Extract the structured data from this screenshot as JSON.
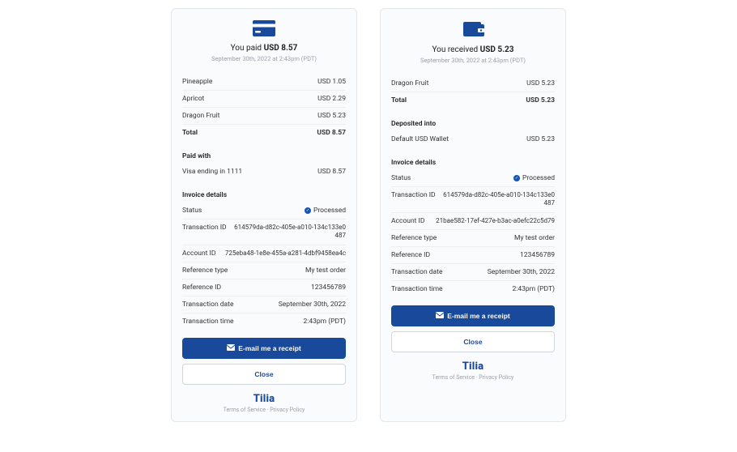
{
  "colors": {
    "primary": "#19499b",
    "muted": "#9aa1a9",
    "border": "#eceef0"
  },
  "left": {
    "title_prefix": "You paid ",
    "title_bold": "USD 8.57",
    "subtitle": "September 30th, 2022 at 2:43pm (PDT)",
    "items": [
      {
        "name": "Pineapple",
        "price": "USD 1.05"
      },
      {
        "name": "Apricot",
        "price": "USD 2.29"
      },
      {
        "name": "Dragon Fruit",
        "price": "USD 5.23"
      }
    ],
    "total": {
      "label": "Total",
      "amount": "USD 8.57"
    },
    "paid_with": {
      "label": "Paid with",
      "method": "Visa ending in 1111",
      "amount": "USD 8.57"
    },
    "invoice_label": "Invoice details",
    "status": {
      "label": "Status",
      "value": "Processed"
    },
    "transaction_id": {
      "label": "Transaction ID",
      "value": "614579da-d82c-405e-a010-134c133e0487"
    },
    "account_id": {
      "label": "Account ID",
      "value": "725eba48-1e8e-455a-a281-4dbf9458ea4c"
    },
    "ref_type": {
      "label": "Reference type",
      "value": "My test order"
    },
    "ref_id": {
      "label": "Reference ID",
      "value": "123456789"
    },
    "tx_date": {
      "label": "Transaction date",
      "value": "September 30th, 2022"
    },
    "tx_time": {
      "label": "Transaction time",
      "value": "2:43pm (PDT)"
    },
    "email_btn": "E-mail me a receipt",
    "close_btn": "Close",
    "brand": "Tilia",
    "footer": "Terms of Service · Privacy Policy"
  },
  "right": {
    "title_prefix": "You received ",
    "title_bold": "USD 5.23",
    "subtitle": "September 30th, 2022 at 2:43pm (PDT)",
    "items": [
      {
        "name": "Dragon Fruit",
        "price": "USD 5.23"
      }
    ],
    "total": {
      "label": "Total",
      "amount": "USD 5.23"
    },
    "deposited": {
      "label": "Deposited into",
      "method": "Default USD Wallet",
      "amount": "USD 5.23"
    },
    "invoice_label": "Invoice details",
    "status": {
      "label": "Status",
      "value": "Processed"
    },
    "transaction_id": {
      "label": "Transaction ID",
      "value": "614579da-d82c-405e-a010-134c133e0487"
    },
    "account_id": {
      "label": "Account ID",
      "value": "21bae582-17ef-427e-b3ac-a0efc22c5d79"
    },
    "ref_type": {
      "label": "Reference type",
      "value": "My test order"
    },
    "ref_id": {
      "label": "Reference ID",
      "value": "123456789"
    },
    "tx_date": {
      "label": "Transaction date",
      "value": "September 30th, 2022"
    },
    "tx_time": {
      "label": "Transaction time",
      "value": "2:43pm (PDT)"
    },
    "email_btn": "E-mail me a receipt",
    "close_btn": "Close",
    "brand": "Tilia",
    "footer": "Terms of Service · Privacy Policy"
  }
}
